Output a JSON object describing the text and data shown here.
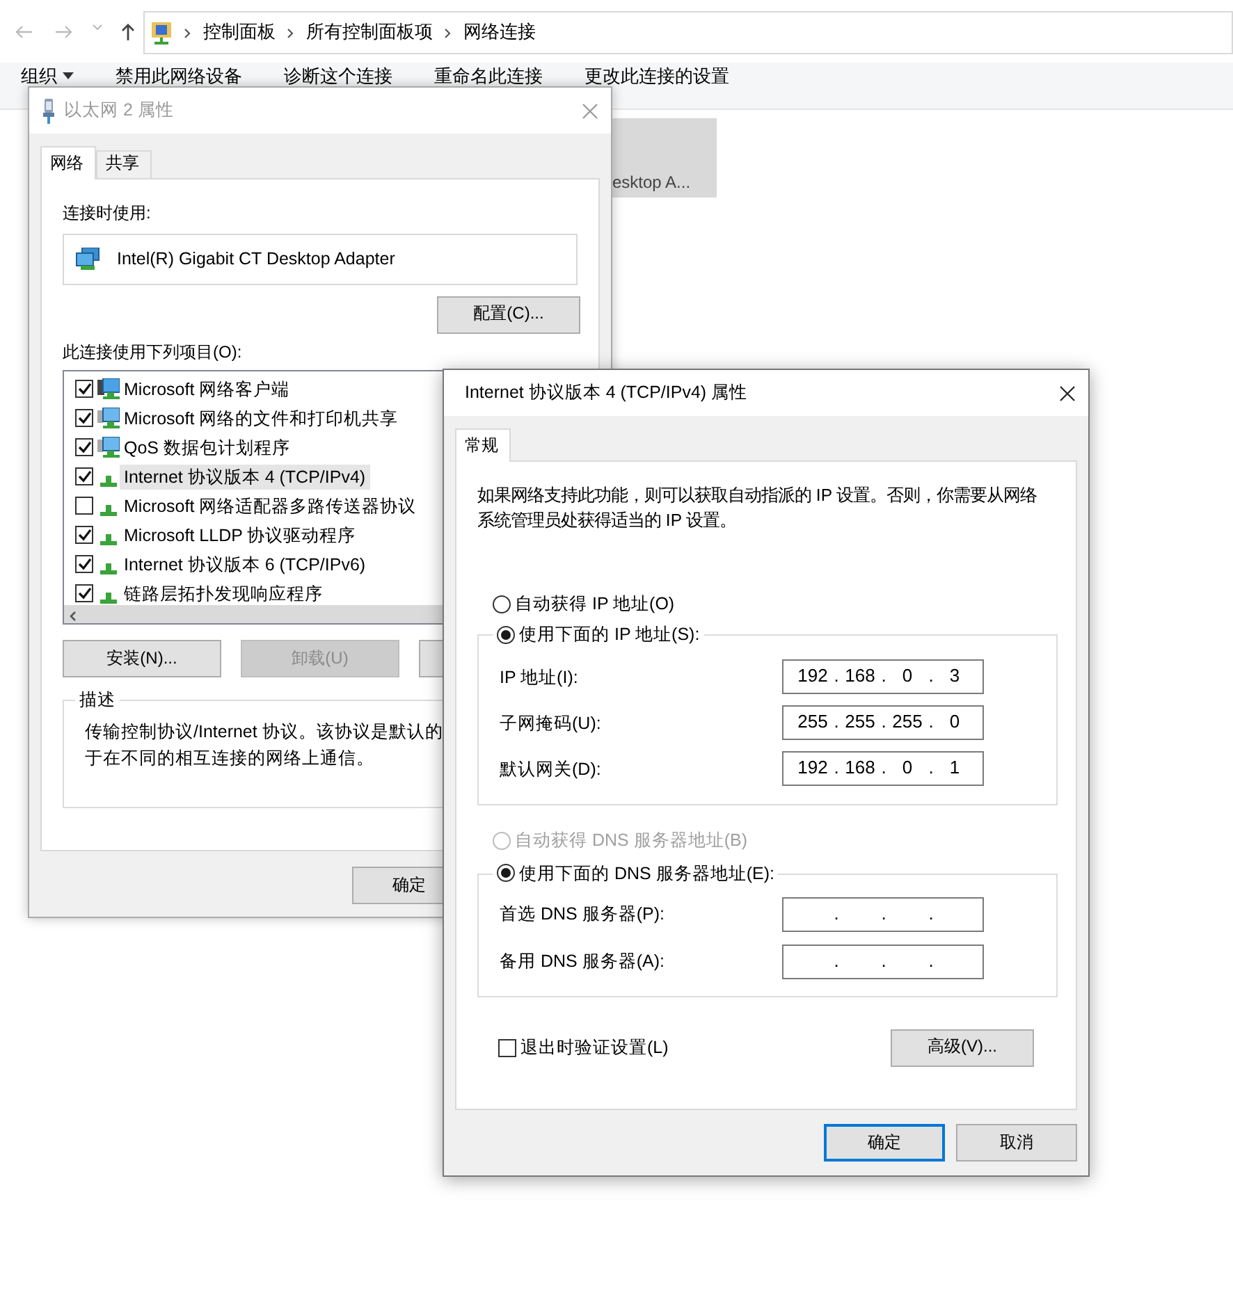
{
  "explorer": {
    "breadcrumb": [
      "控制面板",
      "所有控制面板项",
      "网络连接"
    ],
    "toolbar": [
      {
        "label": "组织",
        "menu": true
      },
      {
        "label": "禁用此网络设备",
        "menu": false
      },
      {
        "label": "诊断这个连接",
        "menu": false
      },
      {
        "label": "重命名此连接",
        "menu": false
      },
      {
        "label": "更改此连接的设置",
        "menu": false
      }
    ],
    "adapter_tile": {
      "label": "esktop A...",
      "selected": true
    }
  },
  "ethernet_dialog": {
    "title": "以太网 2 属性",
    "active": false,
    "tabs": [
      {
        "label": "网络",
        "selected": true
      },
      {
        "label": "共享",
        "selected": false
      }
    ],
    "connect_using_label": "连接时使用:",
    "adapter": "Intel(R) Gigabit CT Desktop Adapter",
    "configure_button": "配置(C)...",
    "items_label": "此连接使用下列项目(O):",
    "items": [
      {
        "label": "Microsoft 网络客户端",
        "kind": "client",
        "checked": true,
        "selected": false
      },
      {
        "label": "Microsoft 网络的文件和打印机共享",
        "kind": "service",
        "checked": true,
        "selected": false
      },
      {
        "label": "QoS 数据包计划程序",
        "kind": "service",
        "checked": true,
        "selected": false
      },
      {
        "label": "Internet 协议版本 4 (TCP/IPv4)",
        "kind": "protocol",
        "checked": true,
        "selected": true
      },
      {
        "label": "Microsoft 网络适配器多路传送器协议",
        "kind": "protocol",
        "checked": false,
        "selected": false
      },
      {
        "label": "Microsoft LLDP 协议驱动程序",
        "kind": "protocol",
        "checked": true,
        "selected": false
      },
      {
        "label": "Internet 协议版本 6 (TCP/IPv6)",
        "kind": "protocol",
        "checked": true,
        "selected": false
      },
      {
        "label": "链路层拓扑发现响应程序",
        "kind": "protocol",
        "checked": true,
        "selected": false
      }
    ],
    "buttons": [
      {
        "label": "安装(N)...",
        "disabled": false
      },
      {
        "label": "卸载(U)",
        "disabled": true
      }
    ],
    "description": {
      "title": "描述",
      "lines": [
        "传输控制协议/Internet 协议。该协议是默认的",
        "于在不同的相互连接的网络上通信。"
      ]
    },
    "ok_button": "确定"
  },
  "ipv4_dialog": {
    "title": "Internet 协议版本 4 (TCP/IPv4) 属性",
    "active": true,
    "tabs": [
      {
        "label": "常规",
        "selected": true
      }
    ],
    "intro": "如果网络支持此功能，则可以获取自动指派的 IP 设置。否则，你需要从网络系统管理员处获得适当的 IP 设置。",
    "ip_modes": [
      {
        "label": "自动获得 IP 地址(O)",
        "selected": false,
        "disabled": false
      },
      {
        "label": "使用下面的 IP 地址(S):",
        "selected": true,
        "disabled": false
      }
    ],
    "ip_fields": [
      {
        "label": "IP 地址(I):",
        "octets": [
          "192",
          "168",
          "0",
          "3"
        ],
        "dots": [
          ".",
          ".",
          "."
        ]
      },
      {
        "label": "子网掩码(U):",
        "octets": [
          "255",
          "255",
          "255",
          "0"
        ],
        "dots": [
          ".",
          ".",
          "."
        ]
      },
      {
        "label": "默认网关(D):",
        "octets": [
          "192",
          "168",
          "0",
          "1"
        ],
        "dots": [
          ".",
          ".",
          "."
        ]
      }
    ],
    "dns_modes": [
      {
        "label": "自动获得 DNS 服务器地址(B)",
        "selected": false,
        "disabled": true
      },
      {
        "label": "使用下面的 DNS 服务器地址(E):",
        "selected": true,
        "disabled": false
      }
    ],
    "dns_fields": [
      {
        "label": "首选 DNS 服务器(P):",
        "dots": [
          ".",
          ".",
          "."
        ]
      },
      {
        "label": "备用 DNS 服务器(A):",
        "dots": [
          ".",
          ".",
          "."
        ]
      }
    ],
    "validate": {
      "label": "退出时验证设置(L)",
      "checked": false
    },
    "advanced_button": "高级(V)...",
    "buttons": [
      {
        "label": "确定",
        "default": true
      },
      {
        "label": "取消",
        "default": false
      }
    ]
  }
}
